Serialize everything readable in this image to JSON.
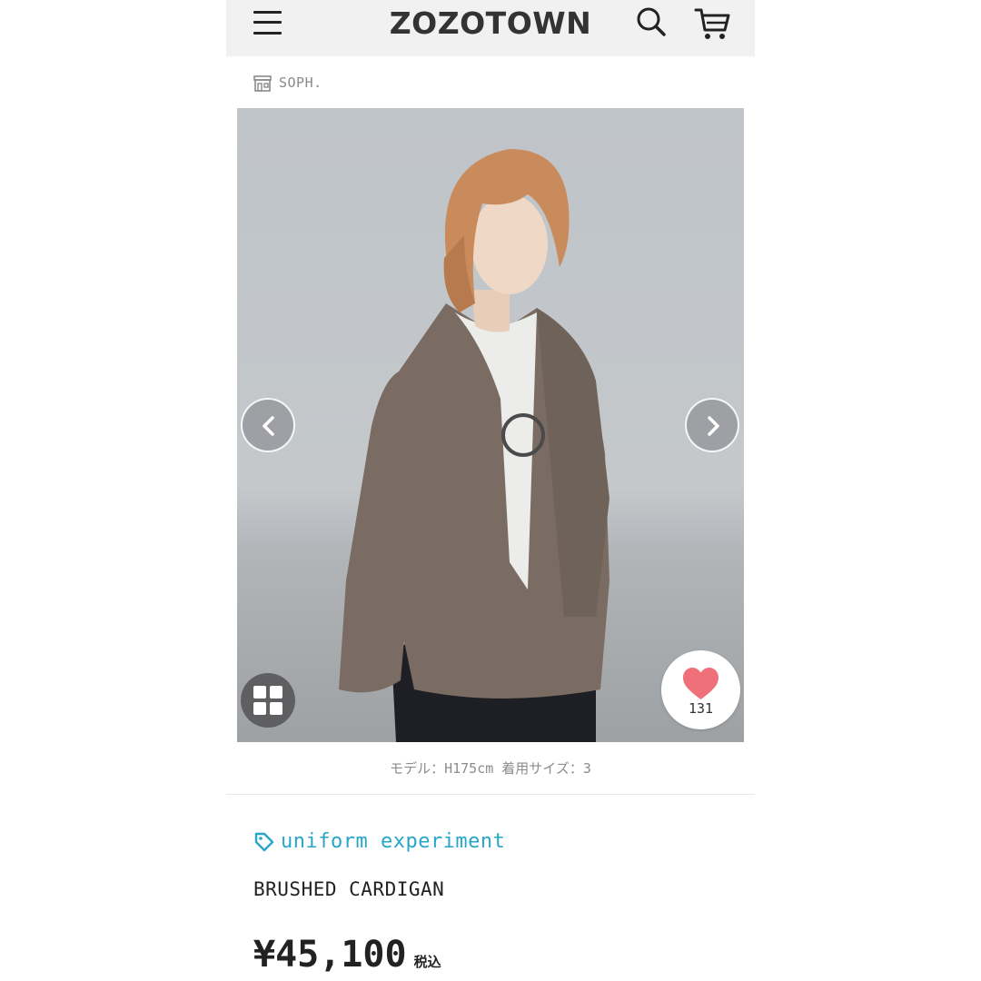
{
  "header": {
    "logo": "ZOZOTOWN",
    "menu_icon": "hamburger-menu-icon",
    "search_icon": "search-icon",
    "cart_icon": "cart-icon"
  },
  "shop": {
    "icon": "shop-icon",
    "name": "SOPH."
  },
  "gallery": {
    "prev_icon": "chevron-left-icon",
    "next_icon": "chevron-right-icon",
    "grid_icon": "grid-icon",
    "favorite": {
      "icon": "heart-icon",
      "count": "131",
      "color": "#f0707a"
    }
  },
  "caption": "モデル：H175cm 着用サイズ：3",
  "product": {
    "brand": "uniform experiment",
    "brand_color": "#27a6c9",
    "name": "BRUSHED CARDIGAN",
    "price": "¥45,100",
    "tax_label": "税込"
  }
}
